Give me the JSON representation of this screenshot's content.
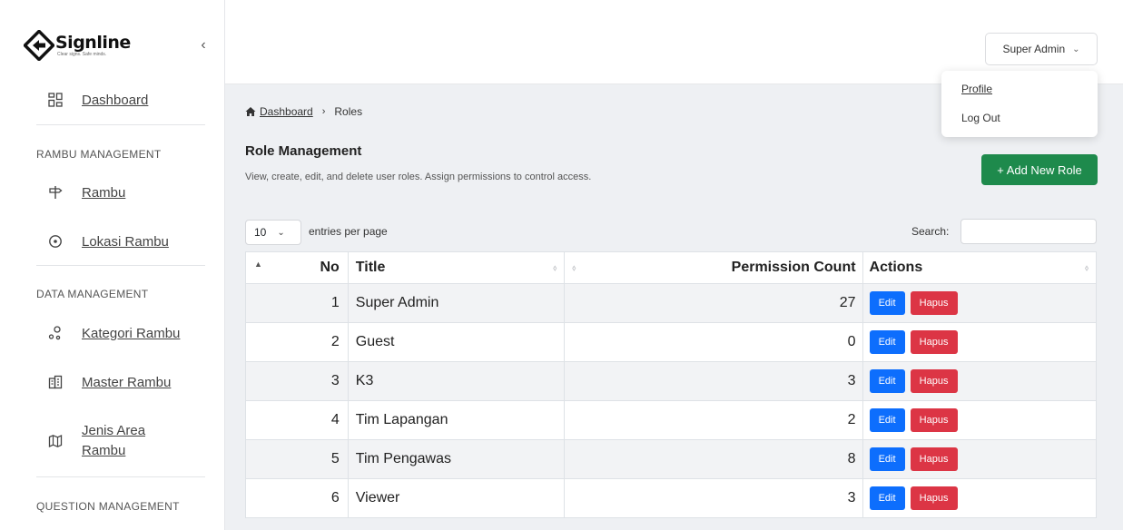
{
  "brand": {
    "name": "Signline",
    "tagline": "Clear signs. Safe minds."
  },
  "sidebar": {
    "collapse_glyph": "‹",
    "dashboard": {
      "label": "Dashboard",
      "icon": "dashboard-grid-icon"
    },
    "sections": [
      {
        "title": "RAMBU MANAGEMENT",
        "items": [
          {
            "label": "Rambu",
            "icon": "signpost-icon"
          },
          {
            "label": "Lokasi Rambu",
            "icon": "location-pin-icon"
          }
        ]
      },
      {
        "title": "DATA MANAGEMENT",
        "items": [
          {
            "label": "Kategori Rambu",
            "icon": "category-nodes-icon"
          },
          {
            "label": "Master Rambu",
            "icon": "building-icon"
          },
          {
            "label": "Jenis Area Rambu",
            "label_line1": "Jenis Area",
            "label_line2": "Rambu",
            "icon": "map-icon"
          }
        ]
      },
      {
        "title": "QUESTION MANAGEMENT",
        "items": []
      }
    ]
  },
  "topbar": {
    "user_label": "Super Admin",
    "caret": "⌄"
  },
  "user_menu": {
    "profile": "Profile",
    "logout": "Log Out"
  },
  "breadcrumb": {
    "home": "Dashboard",
    "separator": "›",
    "current": "Roles"
  },
  "page": {
    "title": "Role Management",
    "description": "View, create, edit, and delete user roles. Assign permissions to control access.",
    "add_button": "+ Add New Role"
  },
  "table_controls": {
    "entries_value": "10",
    "entries_caret": "⌄",
    "entries_label": "entries per page",
    "search_label": "Search:",
    "search_value": ""
  },
  "table": {
    "headers": {
      "no": "No",
      "title": "Title",
      "permission_count": "Permission Count",
      "actions": "Actions"
    },
    "rows": [
      {
        "no": "1",
        "title": "Super Admin",
        "permission_count": "27"
      },
      {
        "no": "2",
        "title": "Guest",
        "permission_count": "0"
      },
      {
        "no": "3",
        "title": "K3",
        "permission_count": "3"
      },
      {
        "no": "4",
        "title": "Tim Lapangan",
        "permission_count": "2"
      },
      {
        "no": "5",
        "title": "Tim Pengawas",
        "permission_count": "8"
      },
      {
        "no": "6",
        "title": "Viewer",
        "permission_count": "3"
      }
    ],
    "edit_label": "Edit",
    "delete_label": "Hapus"
  },
  "colors": {
    "add_green": "#1e8a4c",
    "edit_blue": "#0d6efd",
    "delete_red": "#dc3545"
  }
}
